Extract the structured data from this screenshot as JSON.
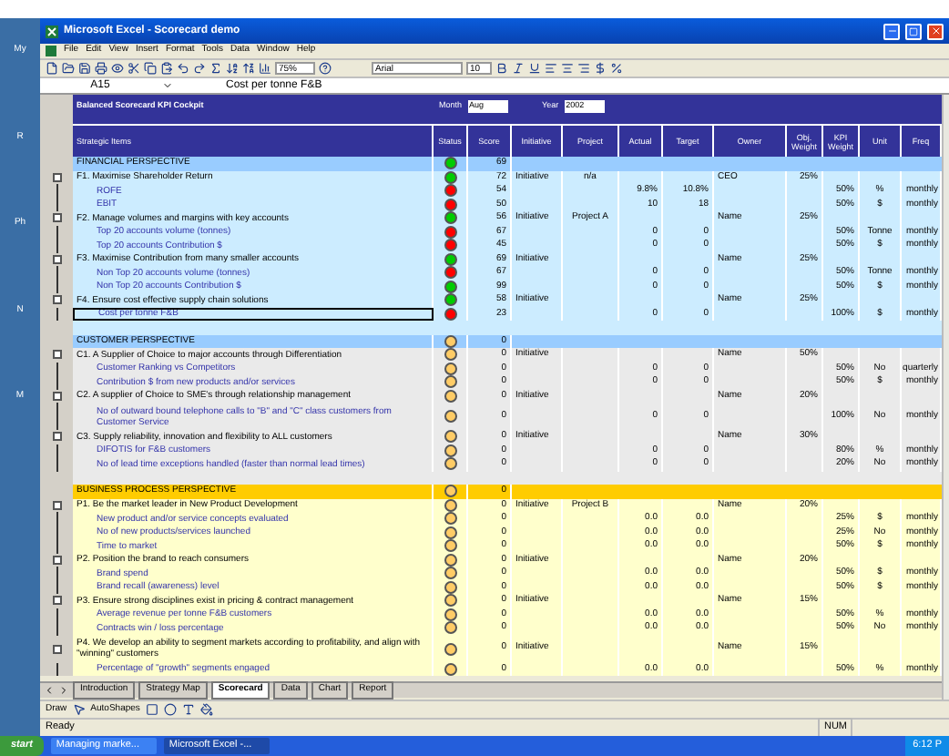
{
  "desktop_labels": [
    "My",
    "R",
    "Ph",
    "N",
    "M"
  ],
  "window": {
    "title": "Microsoft Excel - Scorecard demo"
  },
  "menu": [
    "File",
    "Edit",
    "View",
    "Insert",
    "Format",
    "Tools",
    "Data",
    "Window",
    "Help"
  ],
  "toolbar": {
    "zoom": "75%",
    "font": "Arial",
    "font_size": "10"
  },
  "formula_bar": {
    "name_box": "A15",
    "formula": "Cost per tonne F&B"
  },
  "cockpit": {
    "title": "Balanced Scorecard KPI Cockpit",
    "month_label": "Month",
    "month": "Aug",
    "year_label": "Year",
    "year": "2002"
  },
  "columns": [
    "Strategic Items",
    "Status",
    "Score",
    "Initiative",
    "Project",
    "Actual",
    "Target",
    "Owner",
    "Obj. Weight",
    "KPI Weight",
    "Unit",
    "Freq"
  ],
  "sections": [
    {
      "kind": "financial",
      "title": "FINANCIAL PERSPECTIVE",
      "color": "#00cc00",
      "score": "69",
      "rows": [
        {
          "kind": "objective",
          "text": "F1. Maximise Shareholder Return",
          "color": "#00cc00",
          "score": "72",
          "initiative": "Initiative",
          "project": "n/a",
          "owner": "CEO",
          "obj_weight": "25%",
          "selected": false
        },
        {
          "kind": "kpi",
          "text": "ROFE",
          "color": "#ff0000",
          "score": "54",
          "actual": "9.8%",
          "target": "10.8%",
          "kpi_weight": "50%",
          "unit": "%",
          "freq": "monthly",
          "selected": false
        },
        {
          "kind": "kpi",
          "text": "EBIT",
          "color": "#ff0000",
          "score": "50",
          "actual": "10",
          "target": "18",
          "kpi_weight": "50%",
          "unit": "$",
          "freq": "monthly",
          "selected": false
        },
        {
          "kind": "objective",
          "text": "F2. Manage volumes and margins with key accounts",
          "color": "#00cc00",
          "score": "56",
          "initiative": "Initiative",
          "project": "Project A",
          "owner": "Name",
          "obj_weight": "25%",
          "selected": false
        },
        {
          "kind": "kpi",
          "text": "Top 20 accounts volume (tonnes)",
          "color": "#ff0000",
          "score": "67",
          "actual": "0",
          "target": "0",
          "kpi_weight": "50%",
          "unit": "Tonne",
          "freq": "monthly",
          "selected": false
        },
        {
          "kind": "kpi",
          "text": "Top 20 accounts Contribution $",
          "color": "#ff0000",
          "score": "45",
          "actual": "0",
          "target": "0",
          "kpi_weight": "50%",
          "unit": "$",
          "freq": "monthly",
          "selected": false
        },
        {
          "kind": "objective",
          "text": "F3. Maximise Contribution from many smaller accounts",
          "color": "#00cc00",
          "score": "69",
          "initiative": "Initiative",
          "owner": "Name",
          "obj_weight": "25%",
          "selected": false
        },
        {
          "kind": "kpi",
          "text": "Non Top 20 accounts volume (tonnes)",
          "color": "#ff0000",
          "score": "67",
          "actual": "0",
          "target": "0",
          "kpi_weight": "50%",
          "unit": "Tonne",
          "freq": "monthly",
          "selected": false
        },
        {
          "kind": "kpi",
          "text": "Non Top 20 accounts Contribution $",
          "color": "#00cc00",
          "score": "99",
          "actual": "0",
          "target": "0",
          "kpi_weight": "50%",
          "unit": "$",
          "freq": "monthly",
          "selected": false
        },
        {
          "kind": "objective",
          "text": "F4. Ensure cost effective supply chain solutions",
          "color": "#00cc00",
          "score": "58",
          "initiative": "Initiative",
          "owner": "Name",
          "obj_weight": "25%",
          "selected": false
        },
        {
          "kind": "kpi",
          "text": "Cost per tonne F&B",
          "color": "#ff0000",
          "score": "23",
          "actual": "0",
          "target": "0",
          "kpi_weight": "100%",
          "unit": "$",
          "freq": "monthly",
          "selected": true
        }
      ]
    },
    {
      "kind": "customer",
      "title": "CUSTOMER PERSPECTIVE",
      "color": "#ffcc66",
      "score": "0",
      "rows": [
        {
          "kind": "objective",
          "text": "C1. A Supplier of Choice to major accounts through Differentiation",
          "color": "#ffcc66",
          "score": "0",
          "initiative": "Initiative",
          "owner": "Name",
          "obj_weight": "50%",
          "selected": false
        },
        {
          "kind": "kpi",
          "text": "Customer Ranking vs Competitors",
          "color": "#ffcc66",
          "score": "0",
          "actual": "0",
          "target": "0",
          "kpi_weight": "50%",
          "unit": "No",
          "freq": "quarterly",
          "selected": false
        },
        {
          "kind": "kpi",
          "text": "Contribution $ from new products and/or services",
          "color": "#ffcc66",
          "score": "0",
          "actual": "0",
          "target": "0",
          "kpi_weight": "50%",
          "unit": "$",
          "freq": "monthly",
          "selected": false
        },
        {
          "kind": "objective",
          "text": "C2. A supplier of Choice to SME's through relationship management",
          "color": "#ffcc66",
          "score": "0",
          "initiative": "Initiative",
          "owner": "Name",
          "obj_weight": "20%",
          "selected": false
        },
        {
          "kind": "kpi",
          "text": "No of outward bound telephone calls to \"B\" and \"C\" class customers from Customer Service",
          "color": "#ffcc66",
          "score": "0",
          "actual": "0",
          "target": "0",
          "kpi_weight": "100%",
          "unit": "No",
          "freq": "monthly",
          "selected": false
        },
        {
          "kind": "objective",
          "text": "C3. Supply reliability, innovation and flexibility to ALL customers",
          "color": "#ffcc66",
          "score": "0",
          "initiative": "Initiative",
          "owner": "Name",
          "obj_weight": "30%",
          "selected": false
        },
        {
          "kind": "kpi",
          "text": "DIFOTIS for F&B customers",
          "color": "#ffcc66",
          "score": "0",
          "actual": "0",
          "target": "0",
          "kpi_weight": "80%",
          "unit": "%",
          "freq": "monthly",
          "selected": false
        },
        {
          "kind": "kpi",
          "text": "No of lead time exceptions handled (faster than normal lead times)",
          "color": "#ffcc66",
          "score": "0",
          "actual": "0",
          "target": "0",
          "kpi_weight": "20%",
          "unit": "No",
          "freq": "monthly",
          "selected": false
        }
      ]
    },
    {
      "kind": "process",
      "title": "BUSINESS PROCESS PERSPECTIVE",
      "color": "#ffcc66",
      "score": "0",
      "rows": [
        {
          "kind": "objective",
          "text": "P1. Be the market leader in New Product Development",
          "color": "#ffcc66",
          "score": "0",
          "initiative": "Initiative",
          "project": "Project B",
          "owner": "Name",
          "obj_weight": "20%",
          "selected": false
        },
        {
          "kind": "kpi",
          "text": "New product and/or service concepts evaluated",
          "color": "#ffcc66",
          "score": "0",
          "actual": "0.0",
          "target": "0.0",
          "kpi_weight": "25%",
          "unit": "$",
          "freq": "monthly",
          "selected": false
        },
        {
          "kind": "kpi",
          "text": "No of new products/services launched",
          "color": "#ffcc66",
          "score": "0",
          "actual": "0.0",
          "target": "0.0",
          "kpi_weight": "25%",
          "unit": "No",
          "freq": "monthly",
          "selected": false
        },
        {
          "kind": "kpi",
          "text": "Time to market",
          "color": "#ffcc66",
          "score": "0",
          "actual": "0.0",
          "target": "0.0",
          "kpi_weight": "50%",
          "unit": "$",
          "freq": "monthly",
          "selected": false
        },
        {
          "kind": "objective",
          "text": "P2. Position the brand to reach consumers",
          "color": "#ffcc66",
          "score": "0",
          "initiative": "Initiative",
          "owner": "Name",
          "obj_weight": "20%",
          "selected": false
        },
        {
          "kind": "kpi",
          "text": "Brand spend",
          "color": "#ffcc66",
          "score": "0",
          "actual": "0.0",
          "target": "0.0",
          "kpi_weight": "50%",
          "unit": "$",
          "freq": "monthly",
          "selected": false
        },
        {
          "kind": "kpi",
          "text": "Brand recall (awareness) level",
          "color": "#ffcc66",
          "score": "0",
          "actual": "0.0",
          "target": "0.0",
          "kpi_weight": "50%",
          "unit": "$",
          "freq": "monthly",
          "selected": false
        },
        {
          "kind": "objective",
          "text": "P3. Ensure strong disciplines exist in pricing & contract management",
          "color": "#ffcc66",
          "score": "0",
          "initiative": "Initiative",
          "owner": "Name",
          "obj_weight": "15%",
          "selected": false
        },
        {
          "kind": "kpi",
          "text": "Average revenue per tonne F&B customers",
          "color": "#ffcc66",
          "score": "0",
          "actual": "0.0",
          "target": "0.0",
          "kpi_weight": "50%",
          "unit": "%",
          "freq": "monthly",
          "selected": false
        },
        {
          "kind": "kpi",
          "text": "Contracts win / loss percentage",
          "color": "#ffcc66",
          "score": "0",
          "actual": "0.0",
          "target": "0.0",
          "kpi_weight": "50%",
          "unit": "No",
          "freq": "monthly",
          "selected": false
        },
        {
          "kind": "objective",
          "text": "P4. We develop an ability to segment markets according to profitability, and align with \"winning\" customers",
          "color": "#ffcc66",
          "score": "0",
          "initiative": "Initiative",
          "owner": "Name",
          "obj_weight": "15%",
          "selected": false
        },
        {
          "kind": "kpi",
          "text": "Percentage of \"growth\" segments engaged",
          "color": "#ffcc66",
          "score": "0",
          "actual": "0.0",
          "target": "0.0",
          "kpi_weight": "50%",
          "unit": "%",
          "freq": "monthly",
          "selected": false
        }
      ]
    }
  ],
  "sheet_tabs": [
    {
      "label": "Introduction",
      "selected": false
    },
    {
      "label": "Strategy Map",
      "selected": false
    },
    {
      "label": "Scorecard",
      "selected": true
    },
    {
      "label": "Data",
      "selected": false
    },
    {
      "label": "Chart",
      "selected": false
    },
    {
      "label": "Report",
      "selected": false
    }
  ],
  "drawing_toolbar": {
    "draw": "Draw",
    "autoshapes": "AutoShapes"
  },
  "status_bar": {
    "status": "Ready",
    "num": "NUM"
  },
  "taskbar": {
    "start": "start",
    "tasks": [
      {
        "label": "Managing marke...",
        "selected": false
      },
      {
        "label": "Microsoft Excel -...",
        "selected": true
      }
    ],
    "clock": "6:12 P"
  }
}
